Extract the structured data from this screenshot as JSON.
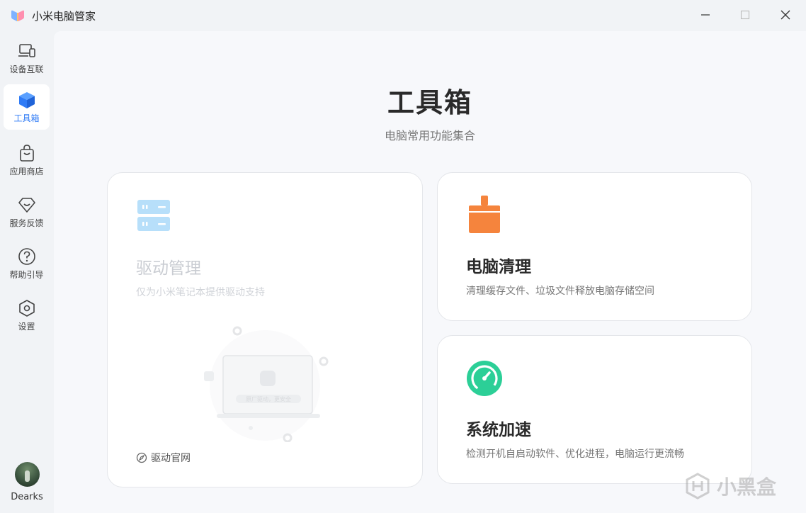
{
  "window": {
    "title": "小米电脑管家",
    "icons": {
      "app_logo": "xiaomi-pc-manager-logo",
      "minimize": "minimize-icon",
      "maximize": "maximize-icon",
      "close": "close-icon"
    }
  },
  "sidebar": {
    "items": [
      {
        "label": "设备互联",
        "icon": "devices-icon",
        "active": false
      },
      {
        "label": "工具箱",
        "icon": "cube-icon",
        "active": true
      },
      {
        "label": "应用商店",
        "icon": "shopping-bag-icon",
        "active": false
      },
      {
        "label": "服务反馈",
        "icon": "diamond-heart-icon",
        "active": false
      },
      {
        "label": "帮助引导",
        "icon": "question-icon",
        "active": false
      },
      {
        "label": "设置",
        "icon": "settings-hexagon-icon",
        "active": false
      }
    ],
    "user": {
      "name": "Dearks",
      "icon": "avatar"
    }
  },
  "main": {
    "title": "工具箱",
    "subtitle": "电脑常用功能集合",
    "cards": {
      "driver": {
        "title": "驱动管理",
        "description": "仅为小米笔记本提供驱动支持",
        "illustration_text": "原厂驱动，更安全",
        "link_label": "驱动官网",
        "icon": "server-icon",
        "disabled": true
      },
      "clean": {
        "title": "电脑清理",
        "description": "清理缓存文件、垃圾文件释放电脑存储空间",
        "icon": "broom-icon"
      },
      "speed": {
        "title": "系统加速",
        "description": "检测开机自启动软件、优化进程，电脑运行更流畅",
        "icon": "speedometer-icon"
      }
    }
  },
  "watermark": {
    "text": "小黑盒"
  },
  "colors": {
    "accent": "#2f7bf6",
    "clean_icon": "#f5843d",
    "speed_icon": "#2ccf97",
    "driver_icon": "#a9d8f8"
  }
}
